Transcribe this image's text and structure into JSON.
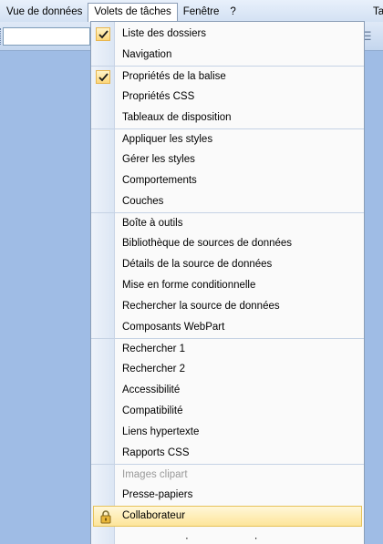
{
  "menubar": {
    "items": [
      {
        "label": "Vue de données"
      },
      {
        "label": "Volets de tâches"
      },
      {
        "label": "Fenêtre"
      },
      {
        "label": "?"
      },
      {
        "label": "Ta"
      }
    ]
  },
  "dropdown": {
    "items": [
      {
        "label": "Liste des dossiers",
        "checked": true
      },
      {
        "label": "Navigation"
      },
      {
        "label": "Propriétés de la balise",
        "checked": true
      },
      {
        "label": "Propriétés CSS"
      },
      {
        "label": "Tableaux de disposition"
      },
      {
        "label": "Appliquer les styles"
      },
      {
        "label": "Gérer les styles"
      },
      {
        "label": "Comportements"
      },
      {
        "label": "Couches"
      },
      {
        "label": "Boîte à outils"
      },
      {
        "label": "Bibliothèque de sources de données"
      },
      {
        "label": "Détails de la source de données"
      },
      {
        "label": "Mise en forme conditionnelle"
      },
      {
        "label": "Rechercher la source de données"
      },
      {
        "label": "Composants WebPart"
      },
      {
        "label": "Rechercher 1"
      },
      {
        "label": "Rechercher 2"
      },
      {
        "label": "Accessibilité"
      },
      {
        "label": "Compatibilité"
      },
      {
        "label": "Liens hypertexte"
      },
      {
        "label": "Rapports CSS"
      },
      {
        "label": "Images clipart",
        "disabled": true
      },
      {
        "label": "Presse-papiers"
      },
      {
        "label": "Collaborateur",
        "icon": "lock-icon",
        "highlighted": true
      },
      {
        "label": "Rétablir la disposition de l'espace de travail"
      }
    ]
  },
  "colors": {
    "desktop": "#9fbce5",
    "highlight": "#fde59a",
    "check_bg": "#fcd67a"
  }
}
